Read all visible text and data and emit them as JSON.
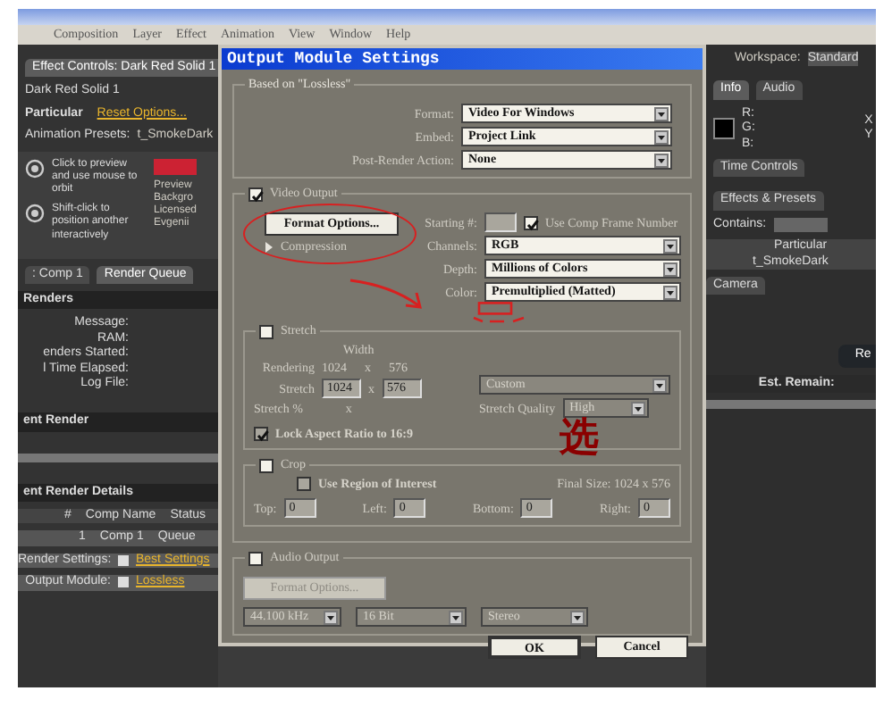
{
  "menu_bar": [
    "Composition",
    "Layer",
    "Effect",
    "Animation",
    "View",
    "Window",
    "Help"
  ],
  "left_panel": {
    "tab": "Effect Controls: Dark Red Solid 1",
    "layer": "Dark Red Solid 1",
    "effect": "Particular",
    "effect_link": "Reset  Options...",
    "presets_label": "Animation Presets:",
    "presets_value": "t_SmokeDark",
    "preview_hints": [
      "Click to preview and use mouse to orbit",
      "Shift-click to position another interactively"
    ],
    "info_lines": [
      "Preview",
      "Backgro",
      "Licensed",
      "Evgenii"
    ],
    "tabs": [
      {
        "label": ": Comp 1",
        "selected": false
      },
      {
        "label": "Render Queue",
        "selected": true
      }
    ],
    "renders_header": "Renders",
    "render_fields": [
      "Message:",
      "RAM:",
      "enders Started:",
      "l Time Elapsed:",
      "Log File:"
    ],
    "current_render": "ent Render",
    "details_header": "ent Render Details",
    "columns": [
      "#",
      "Comp Name",
      "Status"
    ],
    "row": {
      "number": "1",
      "comp": "Comp 1",
      "status": "Queue"
    },
    "settings": [
      {
        "label": "Render Settings:",
        "value": "Best Settings"
      },
      {
        "label": "Output Module:",
        "value": "Lossless"
      }
    ]
  },
  "dialog": {
    "title": "Output Module Settings",
    "based_on": "Based on \"Lossless\"",
    "format_rows": [
      {
        "label": "Format:",
        "value": "Video For Windows"
      },
      {
        "label": "Embed:",
        "value": "Project Link"
      },
      {
        "label": "Post-Render Action:",
        "value": "None"
      }
    ],
    "video_output": {
      "label": "Video Output",
      "checked": true
    },
    "format_options": "Format Options...",
    "compression": "Compression",
    "starting_label": "Starting #:",
    "use_comp_frame": {
      "label": "Use Comp Frame Number",
      "checked": true
    },
    "video_rows": [
      {
        "label": "Channels:",
        "value": "RGB"
      },
      {
        "label": "Depth:",
        "value": "Millions of Colors"
      },
      {
        "label": "Color:",
        "value": "Premultiplied (Matted)"
      }
    ],
    "stretch": {
      "label": "Stretch",
      "checked": false,
      "width_label": "Width",
      "rendering_label": "Rendering",
      "rendering_w": "1024",
      "rendering_x": "x",
      "rendering_h": "576",
      "stretch_label": "Stretch",
      "stretch_w": "1024",
      "stretch_x": "x",
      "stretch_h": "576",
      "preset": "Custom",
      "percent_label": "Stretch %",
      "percent_x": "x",
      "quality_label": "Stretch Quality",
      "quality": "High",
      "lock": {
        "label": "Lock Aspect Ratio to 16:9",
        "checked": true
      }
    },
    "crop": {
      "label": "Crop",
      "checked": false,
      "roi": {
        "label": "Use Region of Interest",
        "checked": false
      },
      "final_size": "Final Size: 1024 x 576",
      "sides": [
        {
          "label": "Top:",
          "value": "0"
        },
        {
          "label": "Left:",
          "value": "0"
        },
        {
          "label": "Bottom:",
          "value": "0"
        },
        {
          "label": "Right:",
          "value": "0"
        }
      ]
    },
    "audio": {
      "label": "Audio Output",
      "checked": false,
      "format_options": "Format Options...",
      "rate": "44.100 kHz",
      "depth": "16 Bit",
      "channels": "Stereo"
    },
    "buttons": [
      "OK",
      "Cancel"
    ]
  },
  "right_panel": {
    "workspace_label": "Workspace:",
    "workspace": "Standard",
    "tabs": [
      {
        "label": "Info",
        "selected": true
      },
      {
        "label": "Audio",
        "selected": false
      }
    ],
    "rgb": [
      "R:",
      "G:",
      "B:"
    ],
    "xy": [
      "X",
      "Y"
    ],
    "time_controls": "Time Controls",
    "effects": "Effects & Presets",
    "contains": "Contains:",
    "tree": [
      "Particular",
      "t_SmokeDark"
    ],
    "camera": "Camera",
    "est_remain": "Est. Remain:",
    "render_button": "Re"
  },
  "annotations": {
    "note": "选"
  }
}
